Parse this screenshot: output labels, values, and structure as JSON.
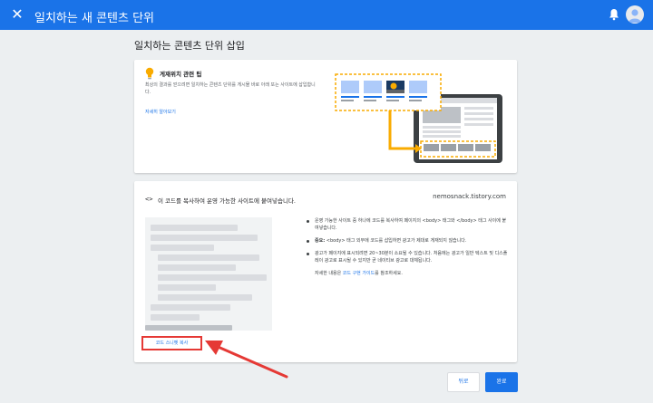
{
  "header": {
    "close_icon": "close-icon",
    "title": "일치하는 새 콘텐츠 단위",
    "bell_icon": "bell-icon",
    "avatar_icon": "avatar-icon"
  },
  "page_title": "일치하는 콘텐츠 단위 삽입",
  "tip_card": {
    "icon": "lightbulb-icon",
    "title": "게재위치 관련 팁",
    "text": "최상의 결과를 얻으려면 일치하는 콘텐츠 단위를 게시물 바로 아래 또는 사이트에 삽입합니다.",
    "link": "자세히 알아보기"
  },
  "code_card": {
    "icon": "code-icon",
    "icon_glyph": "<>",
    "heading": "이 코드를 복사하여 운영 가능한 사이트에 붙여넣습니다.",
    "site": "nemosnack.tistory.com",
    "copy_button": "코드 스니펫 복사",
    "bullets": [
      {
        "prefix": "",
        "text": "운영 가능한 사이트 중 하나에 코드를 복사하여 페이지의 <body> 태그와 </body> 태그 사이에 붙여넣습니다."
      },
      {
        "prefix": "중요:",
        "text": " <body> 태그 외부에 코드를 삽입하면 광고가 제대로 게재되지 않습니다."
      },
      {
        "prefix": "",
        "text": "광고가 페이지에 표시되려면 20~30분이 소요될 수 있습니다. 처음에는 광고가 일반 텍스트 및 디스플레이 광고로 표시될 수 있지만 곧 네이티브 광고로 대체됩니다."
      }
    ],
    "note_before": "자세한 내용은 ",
    "note_link": "코드 구현 가이드",
    "note_after": "를 참조하세요."
  },
  "footer": {
    "back_label": "뒤로",
    "done_label": "완료"
  },
  "colors": {
    "primary": "#1a73e8",
    "highlight": "#e53935",
    "accent": "#f9ab00"
  }
}
